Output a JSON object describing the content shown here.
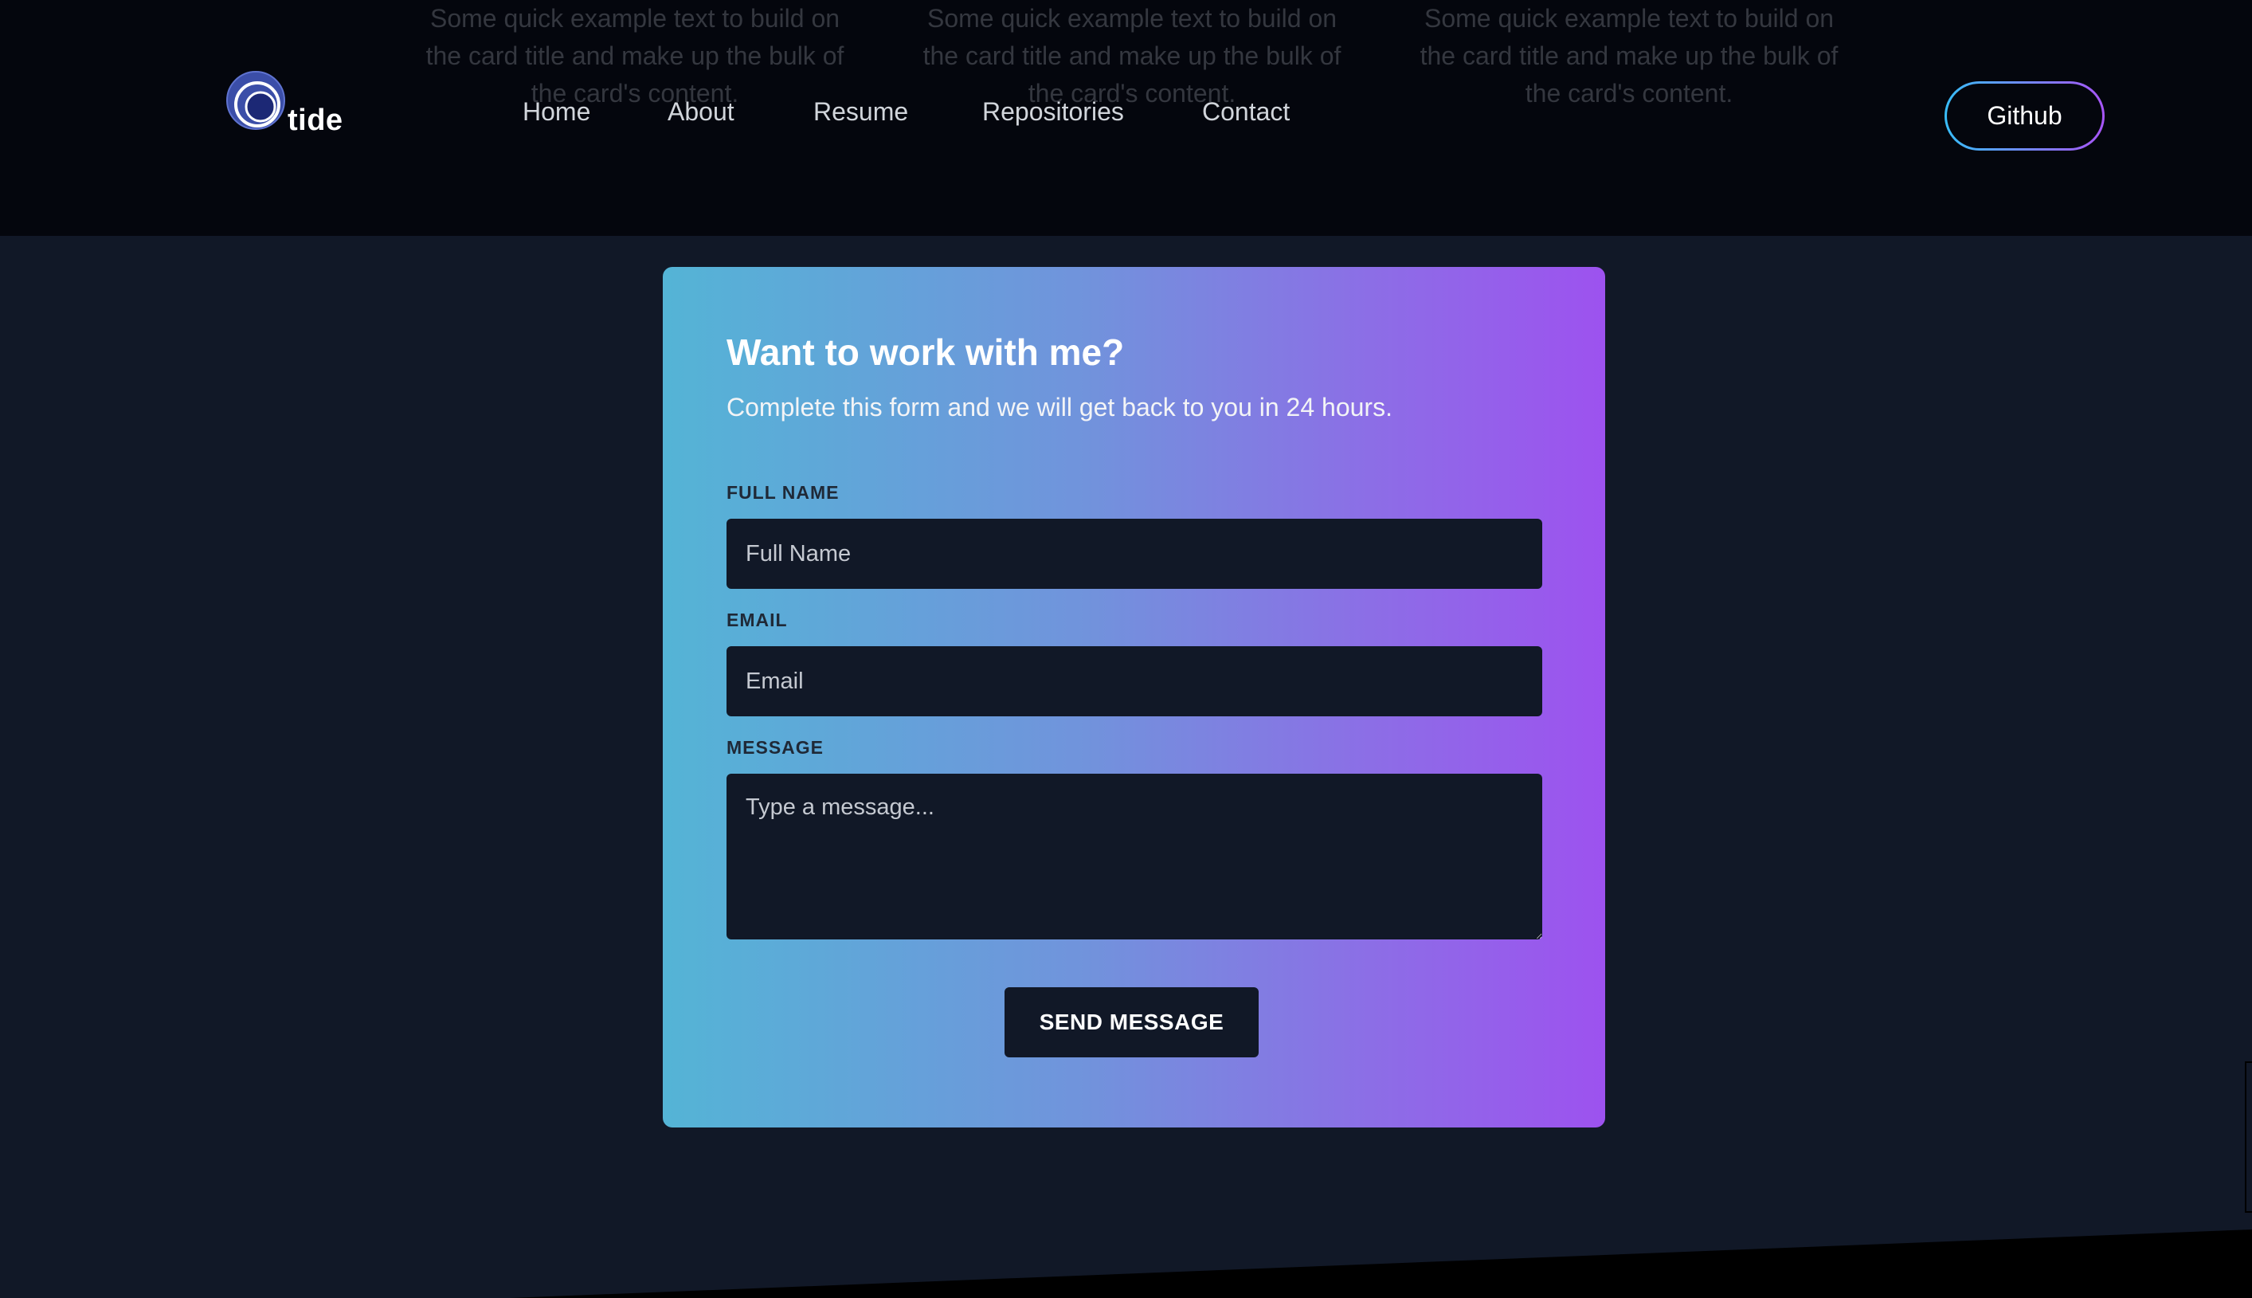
{
  "header": {
    "faded_card_text": [
      "Some quick example text to build on the card title and make up the bulk of the card's content.",
      "Some quick example text to build on the card title and make up the bulk of the card's content.",
      "Some quick example text to build on the card title and make up the bulk of the card's content."
    ],
    "logo_text": "tide",
    "nav": [
      "Home",
      "About",
      "Resume",
      "Repositories",
      "Contact"
    ],
    "github_label": "Github"
  },
  "form": {
    "title": "Want to work with me?",
    "subtitle": "Complete this form and we will get back to you in 24 hours.",
    "fields": {
      "full_name": {
        "label": "FULL NAME",
        "placeholder": "Full Name",
        "value": ""
      },
      "email": {
        "label": "EMAIL",
        "placeholder": "Email",
        "value": ""
      },
      "message": {
        "label": "MESSAGE",
        "placeholder": "Type a message...",
        "value": ""
      }
    },
    "submit_label": "SEND MESSAGE"
  },
  "colors": {
    "page_background": "#111827",
    "header_background": "#04060d",
    "gradient_start": "#54b4d6",
    "gradient_end": "#9d52ef",
    "input_background": "#111827",
    "github_border_start": "#38bdf8",
    "github_border_end": "#a855f7"
  },
  "icons": {
    "logo": "tide-wave-logo-icon"
  }
}
